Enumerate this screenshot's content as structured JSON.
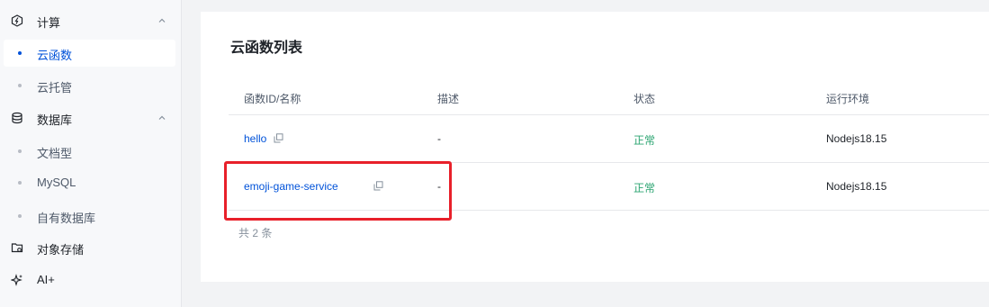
{
  "sidebar": {
    "groups": [
      {
        "label": "计算",
        "icon": "compute-icon",
        "items": [
          "云函数",
          "云托管"
        ]
      },
      {
        "label": "数据库",
        "icon": "database-icon",
        "items": [
          "文档型",
          "MySQL",
          "自有数据库"
        ]
      },
      {
        "label": "对象存储",
        "icon": "storage-icon"
      },
      {
        "label": "AI+",
        "icon": "sparkle-icon"
      }
    ],
    "active_item": "云函数"
  },
  "main": {
    "title": "云函数列表",
    "columns": [
      "函数ID/名称",
      "描述",
      "状态",
      "运行环境"
    ],
    "rows": [
      {
        "name": "hello",
        "description": "-",
        "status": "正常",
        "runtime": "Nodejs18.15"
      },
      {
        "name": "emoji-game-service",
        "description": "-",
        "status": "正常",
        "runtime": "Nodejs18.15"
      }
    ],
    "total": "共 2 条"
  },
  "colors": {
    "accent": "#0052d9",
    "status_ok": "#2ba471",
    "highlight": "#e8202a"
  }
}
